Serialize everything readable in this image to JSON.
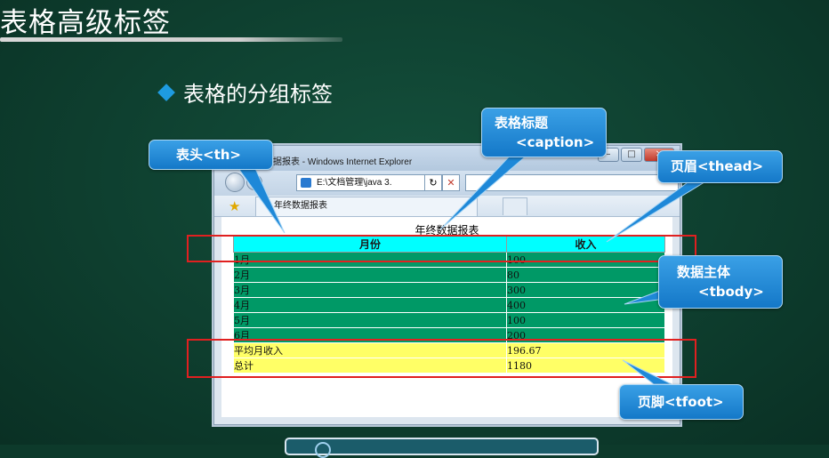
{
  "slide": {
    "title": "表格高级标签",
    "subtitle": "表格的分组标签"
  },
  "browser": {
    "window_title": "据报表 - Windows Internet Explorer",
    "address": "E:\\文档管理\\java 3.",
    "tab_label": "年终数据报表",
    "win_buttons": [
      "–",
      "□",
      "✕"
    ]
  },
  "table": {
    "caption": "年终数据报表",
    "headers": [
      "月份",
      "收入"
    ],
    "body_rows": [
      [
        "1月",
        "100"
      ],
      [
        "2月",
        "80"
      ],
      [
        "3月",
        "300"
      ],
      [
        "4月",
        "400"
      ],
      [
        "5月",
        "100"
      ],
      [
        "6月",
        "200"
      ]
    ],
    "foot_rows": [
      [
        "平均月收入",
        "196.67"
      ],
      [
        "总计",
        "1180"
      ]
    ]
  },
  "callouts": {
    "th": "表头<th>",
    "caption_l1": "表格标题",
    "caption_l2": "<caption>",
    "thead": "页眉<thead>",
    "tbody_l1": "数据主体",
    "tbody_l2": "<tbody>",
    "tfoot": "页脚<tfoot>"
  },
  "colors": {
    "background": "#0e3f2f",
    "header_fill": "#00ffff",
    "body_fill": "#009966",
    "foot_fill": "#ffff66",
    "callout": "#1e88d8",
    "highlight": "#e02020"
  }
}
